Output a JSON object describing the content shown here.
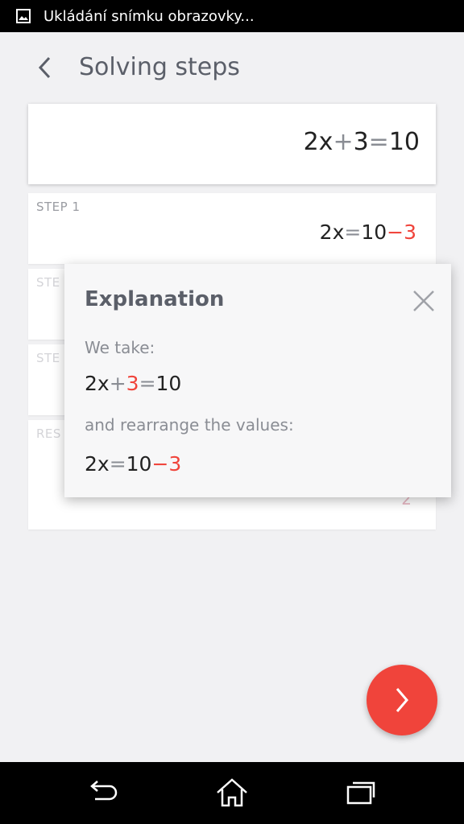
{
  "status_bar": {
    "text": "Ukládání snímku obrazovky...",
    "icon": "image-icon"
  },
  "header": {
    "title": "Solving steps",
    "back_icon": "chevron-left-icon"
  },
  "equation": {
    "lhs": "2x",
    "op": "+",
    "num": "3",
    "eq": "=",
    "rhs": "10"
  },
  "steps": [
    {
      "label": "STEP 1",
      "lhs": "2x",
      "eq": "=",
      "rhs": "10",
      "op": "−",
      "num": "3"
    },
    {
      "label": "STE"
    },
    {
      "label": "STE"
    },
    {
      "label": "RES",
      "value": "2"
    }
  ],
  "explanation": {
    "title": "Explanation",
    "line1": "We take:",
    "eq1": {
      "lhs": "2x",
      "op": "+",
      "num": "3",
      "eq": "=",
      "rhs": "10"
    },
    "line2": "and rearrange the values:",
    "eq2": {
      "lhs": "2x",
      "eq": "=",
      "rhs": "10",
      "op": "−",
      "num": "3"
    }
  },
  "fab": {
    "icon": "chevron-right-icon"
  },
  "nav": {
    "back": "back-icon",
    "home": "home-icon",
    "recents": "recents-icon"
  },
  "colors": {
    "accent": "#f0443b",
    "text": "#222222",
    "muted": "#8a8d94"
  }
}
